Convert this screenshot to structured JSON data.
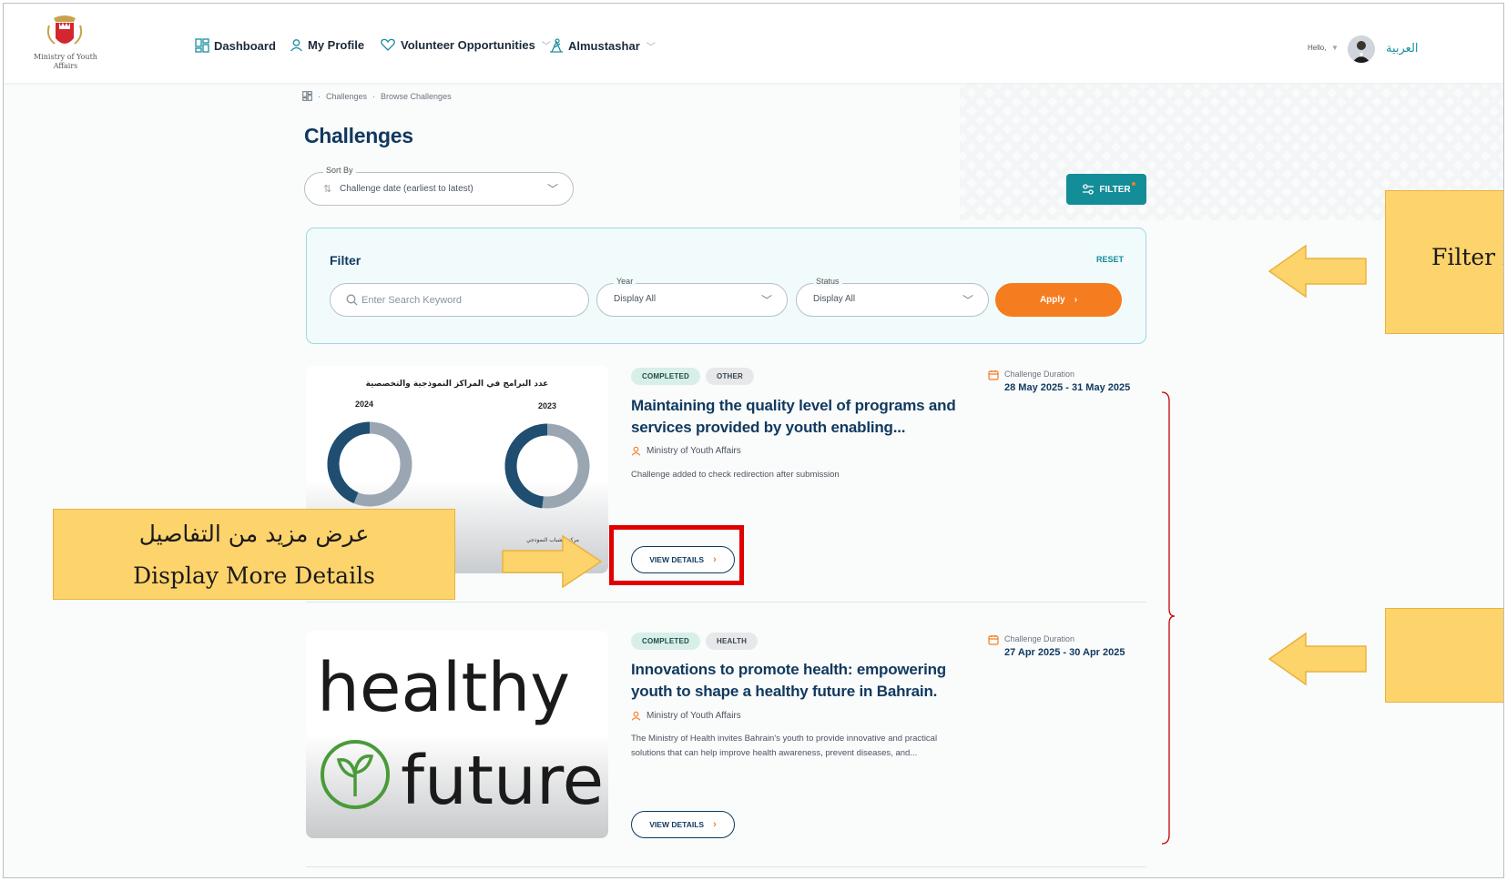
{
  "header": {
    "logo_text": "Ministry of Youth Affairs",
    "nav": [
      {
        "label": "Dashboard",
        "icon": "dashboard-icon"
      },
      {
        "label": "My Profile",
        "icon": "user-icon"
      },
      {
        "label": "Volunteer Opportunities",
        "icon": "heart-hand-icon",
        "dropdown": true
      },
      {
        "label": "Almustashar",
        "icon": "consultant-icon",
        "dropdown": true
      }
    ],
    "hello": "Hello,",
    "language": "العربية"
  },
  "breadcrumb": [
    "Challenges",
    "Browse Challenges"
  ],
  "page_title": "Challenges",
  "sort": {
    "label": "Sort By",
    "value": "Challenge date (earliest to latest)"
  },
  "filter_button": "FILTER",
  "filter_panel": {
    "title": "Filter",
    "reset": "RESET",
    "search_placeholder": "Enter Search Keyword",
    "year": {
      "label": "Year",
      "value": "Display All"
    },
    "status": {
      "label": "Status",
      "value": "Display All"
    },
    "apply": "Apply"
  },
  "challenges": [
    {
      "status": "COMPLETED",
      "category": "OTHER",
      "title": "Maintaining the quality level of programs and services provided by youth enabling...",
      "organization": "Ministry of Youth Affairs",
      "description": "Challenge added to check redirection after submission",
      "duration_label": "Challenge Duration",
      "duration": "28 May 2025 - 31 May 2025",
      "action": "VIEW DETAILS",
      "image": {
        "title": "عدد البرامج في المراكز النموذجية والتخصصية",
        "year_left": "2024",
        "year_right": "2023",
        "caption": "مركز الشباب النموذجي"
      }
    },
    {
      "status": "COMPLETED",
      "category": "HEALTH",
      "title": "Innovations to promote health: empowering youth to shape a healthy future in Bahrain.",
      "organization": "Ministry of Youth Affairs",
      "description": "The Ministry of Health invites Bahrain's youth to provide innovative and practical solutions that can help improve health awareness, prevent diseases, and...",
      "duration_label": "Challenge Duration",
      "duration": "27 Apr 2025 - 30 Apr 2025",
      "action": "VIEW DETAILS",
      "image": {
        "word1": "healthy",
        "word2": "future"
      }
    }
  ],
  "annotations": {
    "details_ar": "عرض مزيد من التفاصيل",
    "details_en": "Display More Details",
    "filter_partial": "Filter b"
  },
  "colors": {
    "primary": "#10395e",
    "teal": "#138d97",
    "orange": "#f57c1f",
    "callout": "#fdd36c",
    "highlight": "#e00000"
  }
}
